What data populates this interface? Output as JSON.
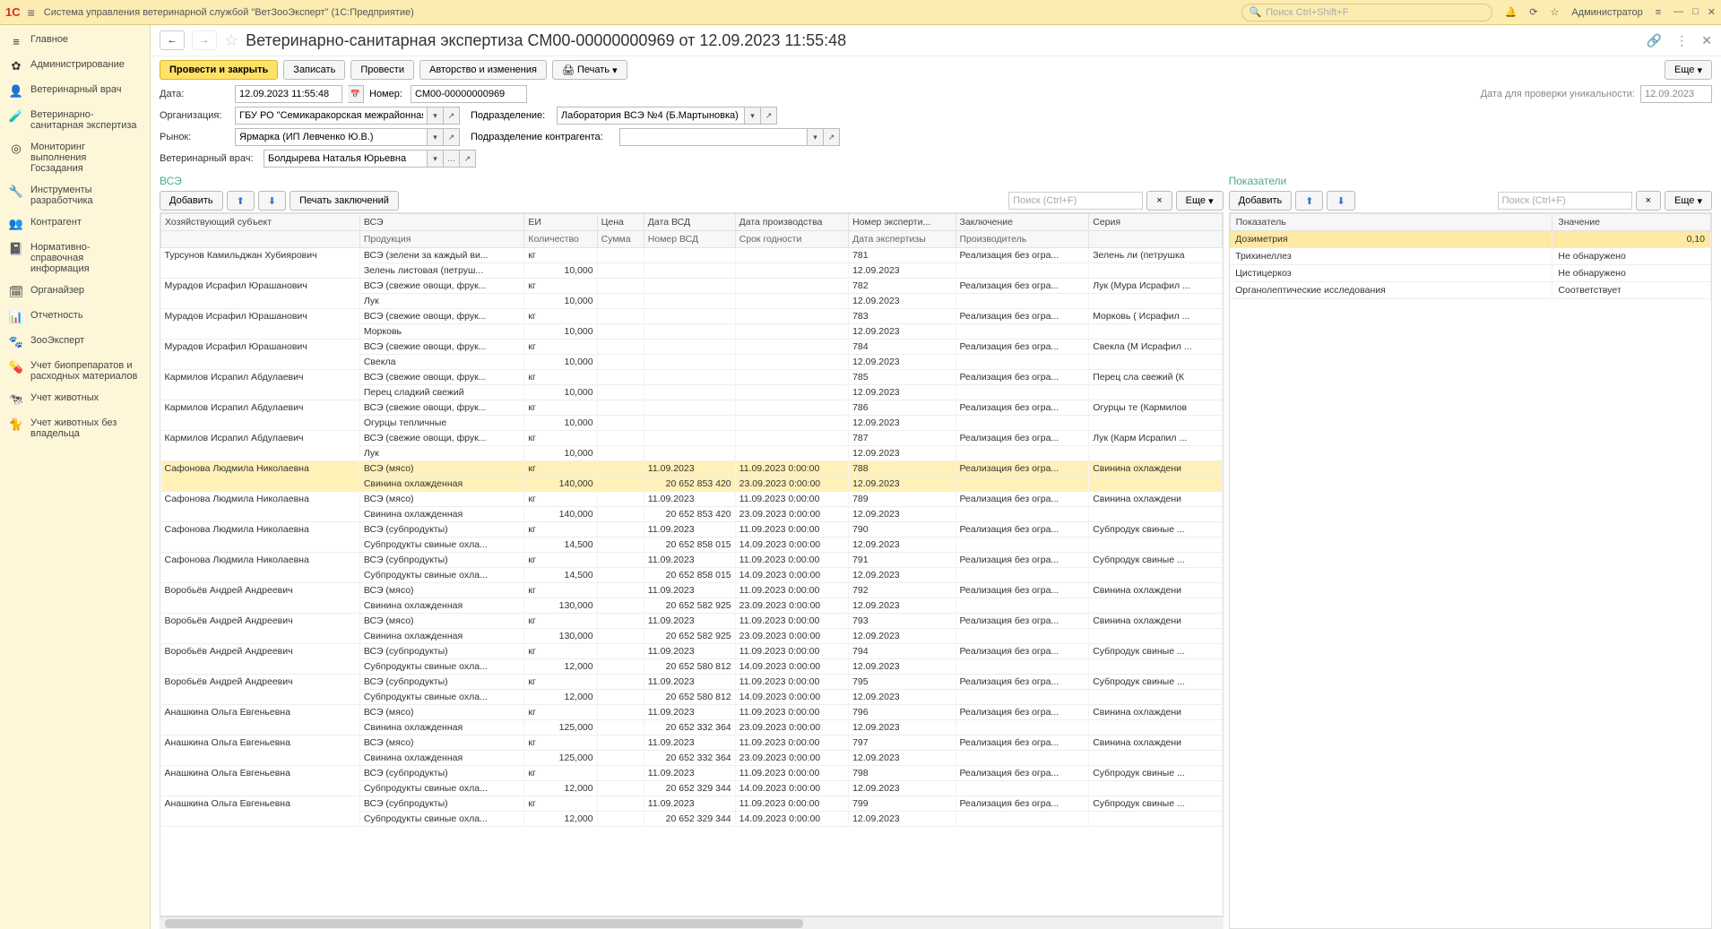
{
  "titlebar": {
    "app_title": "Система управления ветеринарной службой \"ВетЗооЭксперт\"  (1С:Предприятие)",
    "search_placeholder": "Поиск Ctrl+Shift+F",
    "user": "Администратор"
  },
  "sidebar": [
    {
      "icon": "≡",
      "label": "Главное"
    },
    {
      "icon": "✿",
      "label": "Администрирование"
    },
    {
      "icon": "👤",
      "label": "Ветеринарный врач"
    },
    {
      "icon": "🧪",
      "label": "Ветеринарно-санитарная экспертиза"
    },
    {
      "icon": "◎",
      "label": "Мониторинг выполнения Госзадания"
    },
    {
      "icon": "🔧",
      "label": "Инструменты разработчика"
    },
    {
      "icon": "👥",
      "label": "Контрагент"
    },
    {
      "icon": "📓",
      "label": "Нормативно-справочная информация"
    },
    {
      "icon": "🗓",
      "label": "Органайзер"
    },
    {
      "icon": "📊",
      "label": "Отчетность"
    },
    {
      "icon": "🐾",
      "label": "ЗооЭксперт"
    },
    {
      "icon": "💊",
      "label": "Учет биопрепаратов и расходных материалов"
    },
    {
      "icon": "🐄",
      "label": "Учет животных"
    },
    {
      "icon": "🐈",
      "label": "Учет животных без владельца"
    }
  ],
  "doc": {
    "title": "Ветеринарно-санитарная экспертиза СМ00-00000000969 от 12.09.2023 11:55:48",
    "btn_post_close": "Провести и закрыть",
    "btn_write": "Записать",
    "btn_post": "Провести",
    "btn_author": "Авторство и изменения",
    "btn_print": "Печать",
    "btn_more": "Еще"
  },
  "form": {
    "date_label": "Дата:",
    "date_value": "12.09.2023 11:55:48",
    "number_label": "Номер:",
    "number_value": "СМ00-00000000969",
    "unique_label": "Дата для проверки уникальности:",
    "unique_value": "12.09.2023",
    "org_label": "Организация:",
    "org_value": "ГБУ РО \"Семикаракорская межрайонная СББЖ\"",
    "dept_label": "Подразделение:",
    "dept_value": "Лаборатория ВСЭ №4 (Б.Мартыновка)",
    "market_label": "Рынок:",
    "market_value": "Ярмарка (ИП Левченко Ю.В.)",
    "cdept_label": "Подразделение контрагента:",
    "cdept_value": "",
    "vet_label": "Ветеринарный врач:",
    "vet_value": "Болдырева Наталья Юрьевна"
  },
  "vse_section": {
    "title": "ВСЭ",
    "btn_add": "Добавить",
    "btn_print_conclusion": "Печать заключений",
    "search_placeholder": "Поиск (Ctrl+F)",
    "btn_more": "Еще",
    "headers1": [
      "Хозяйствующий субъект",
      "ВСЭ",
      "ЕИ",
      "Цена",
      "Дата ВСД",
      "Дата производства",
      "Номер эксперти...",
      "Заключение",
      "Серия"
    ],
    "headers2": [
      "",
      "Продукция",
      "Количество",
      "Сумма",
      "Номер ВСД",
      "Срок годности",
      "Дата экспертизы",
      "Производитель",
      ""
    ],
    "rows": [
      {
        "subj": "Турсунов Камильджан Хубиярович",
        "vse": "ВСЭ (зелени за каждый ви...",
        "prod": "Зелень листовая (петруш...",
        "ei": "кг",
        "qty": "10,000",
        "vsd_date": "",
        "prod_date": "",
        "num": "781",
        "exp_date": "12.09.2023",
        "concl": "Реализация без огра...",
        "series": "Зелень ли (петрушка"
      },
      {
        "subj": "Мурадов Исрафил Юрашанович",
        "vse": "ВСЭ (свежие овощи, фрук...",
        "prod": "Лук",
        "ei": "кг",
        "qty": "10,000",
        "vsd_date": "",
        "prod_date": "",
        "num": "782",
        "exp_date": "12.09.2023",
        "concl": "Реализация без огра...",
        "series": "Лук (Мура Исрафил ..."
      },
      {
        "subj": "Мурадов Исрафил Юрашанович",
        "vse": "ВСЭ (свежие овощи, фрук...",
        "prod": "Морковь",
        "ei": "кг",
        "qty": "10,000",
        "vsd_date": "",
        "prod_date": "",
        "num": "783",
        "exp_date": "12.09.2023",
        "concl": "Реализация без огра...",
        "series": "Морковь ( Исрафил ..."
      },
      {
        "subj": "Мурадов Исрафил Юрашанович",
        "vse": "ВСЭ (свежие овощи, фрук...",
        "prod": "Свекла",
        "ei": "кг",
        "qty": "10,000",
        "vsd_date": "",
        "prod_date": "",
        "num": "784",
        "exp_date": "12.09.2023",
        "concl": "Реализация без огра...",
        "series": "Свекла (М Исрафил ..."
      },
      {
        "subj": "Кармилов Исрапил Абдулаевич",
        "vse": "ВСЭ (свежие овощи, фрук...",
        "prod": "Перец сладкий свежий",
        "ei": "кг",
        "qty": "10,000",
        "vsd_date": "",
        "prod_date": "",
        "num": "785",
        "exp_date": "12.09.2023",
        "concl": "Реализация без огра...",
        "series": "Перец сла свежий (К"
      },
      {
        "subj": "Кармилов Исрапил Абдулаевич",
        "vse": "ВСЭ (свежие овощи, фрук...",
        "prod": "Огурцы тепличные",
        "ei": "кг",
        "qty": "10,000",
        "vsd_date": "",
        "prod_date": "",
        "num": "786",
        "exp_date": "12.09.2023",
        "concl": "Реализация без огра...",
        "series": "Огурцы те (Кармилов"
      },
      {
        "subj": "Кармилов Исрапил Абдулаевич",
        "vse": "ВСЭ (свежие овощи, фрук...",
        "prod": "Лук",
        "ei": "кг",
        "qty": "10,000",
        "vsd_date": "",
        "prod_date": "",
        "num": "787",
        "exp_date": "12.09.2023",
        "concl": "Реализация без огра...",
        "series": "Лук (Карм Исрапил ..."
      },
      {
        "sel": true,
        "subj": "Сафонова Людмила Николаевна",
        "vse": "ВСЭ (мясо)",
        "prod": "Свинина охлажденная",
        "ei": "кг",
        "qty": "140,000",
        "vsd_date": "11.09.2023",
        "vsd_num": "20 652 853 420",
        "prod_date": "11.09.2023 0:00:00",
        "exp": "23.09.2023 0:00:00",
        "num": "788",
        "exp_date": "12.09.2023",
        "concl": "Реализация без огра...",
        "series": "Свинина охлаждени"
      },
      {
        "subj": "Сафонова Людмила Николаевна",
        "vse": "ВСЭ (мясо)",
        "prod": "Свинина охлажденная",
        "ei": "кг",
        "qty": "140,000",
        "vsd_date": "11.09.2023",
        "vsd_num": "20 652 853 420",
        "prod_date": "11.09.2023 0:00:00",
        "exp": "23.09.2023 0:00:00",
        "num": "789",
        "exp_date": "12.09.2023",
        "concl": "Реализация без огра...",
        "series": "Свинина охлаждени"
      },
      {
        "subj": "Сафонова Людмила Николаевна",
        "vse": "ВСЭ (субпродукты)",
        "prod": "Субпродукты свиные охла...",
        "ei": "кг",
        "qty": "14,500",
        "vsd_date": "11.09.2023",
        "vsd_num": "20 652 858 015",
        "prod_date": "11.09.2023 0:00:00",
        "exp": "14.09.2023 0:00:00",
        "num": "790",
        "exp_date": "12.09.2023",
        "concl": "Реализация без огра...",
        "series": "Субпродук свиные ..."
      },
      {
        "subj": "Сафонова Людмила Николаевна",
        "vse": "ВСЭ (субпродукты)",
        "prod": "Субпродукты свиные охла...",
        "ei": "кг",
        "qty": "14,500",
        "vsd_date": "11.09.2023",
        "vsd_num": "20 652 858 015",
        "prod_date": "11.09.2023 0:00:00",
        "exp": "14.09.2023 0:00:00",
        "num": "791",
        "exp_date": "12.09.2023",
        "concl": "Реализация без огра...",
        "series": "Субпродук свиные ..."
      },
      {
        "subj": "Воробьёв Андрей Андреевич",
        "vse": "ВСЭ (мясо)",
        "prod": "Свинина охлажденная",
        "ei": "кг",
        "qty": "130,000",
        "vsd_date": "11.09.2023",
        "vsd_num": "20 652 582 925",
        "prod_date": "11.09.2023 0:00:00",
        "exp": "23.09.2023 0:00:00",
        "num": "792",
        "exp_date": "12.09.2023",
        "concl": "Реализация без огра...",
        "series": "Свинина охлаждени"
      },
      {
        "subj": "Воробьёв Андрей Андреевич",
        "vse": "ВСЭ (мясо)",
        "prod": "Свинина охлажденная",
        "ei": "кг",
        "qty": "130,000",
        "vsd_date": "11.09.2023",
        "vsd_num": "20 652 582 925",
        "prod_date": "11.09.2023 0:00:00",
        "exp": "23.09.2023 0:00:00",
        "num": "793",
        "exp_date": "12.09.2023",
        "concl": "Реализация без огра...",
        "series": "Свинина охлаждени"
      },
      {
        "subj": "Воробьёв Андрей Андреевич",
        "vse": "ВСЭ (субпродукты)",
        "prod": "Субпродукты свиные охла...",
        "ei": "кг",
        "qty": "12,000",
        "vsd_date": "11.09.2023",
        "vsd_num": "20 652 580 812",
        "prod_date": "11.09.2023 0:00:00",
        "exp": "14.09.2023 0:00:00",
        "num": "794",
        "exp_date": "12.09.2023",
        "concl": "Реализация без огра...",
        "series": "Субпродук свиные ..."
      },
      {
        "subj": "Воробьёв Андрей Андреевич",
        "vse": "ВСЭ (субпродукты)",
        "prod": "Субпродукты свиные охла...",
        "ei": "кг",
        "qty": "12,000",
        "vsd_date": "11.09.2023",
        "vsd_num": "20 652 580 812",
        "prod_date": "11.09.2023 0:00:00",
        "exp": "14.09.2023 0:00:00",
        "num": "795",
        "exp_date": "12.09.2023",
        "concl": "Реализация без огра...",
        "series": "Субпродук свиные ..."
      },
      {
        "subj": "Анашкина Ольга Евгеньевна",
        "vse": "ВСЭ (мясо)",
        "prod": "Свинина охлажденная",
        "ei": "кг",
        "qty": "125,000",
        "vsd_date": "11.09.2023",
        "vsd_num": "20 652 332 364",
        "prod_date": "11.09.2023 0:00:00",
        "exp": "23.09.2023 0:00:00",
        "num": "796",
        "exp_date": "12.09.2023",
        "concl": "Реализация без огра...",
        "series": "Свинина охлаждени"
      },
      {
        "subj": "Анашкина Ольга Евгеньевна",
        "vse": "ВСЭ (мясо)",
        "prod": "Свинина охлажденная",
        "ei": "кг",
        "qty": "125,000",
        "vsd_date": "11.09.2023",
        "vsd_num": "20 652 332 364",
        "prod_date": "11.09.2023 0:00:00",
        "exp": "23.09.2023 0:00:00",
        "num": "797",
        "exp_date": "12.09.2023",
        "concl": "Реализация без огра...",
        "series": "Свинина охлаждени"
      },
      {
        "subj": "Анашкина Ольга Евгеньевна",
        "vse": "ВСЭ (субпродукты)",
        "prod": "Субпродукты свиные охла...",
        "ei": "кг",
        "qty": "12,000",
        "vsd_date": "11.09.2023",
        "vsd_num": "20 652 329 344",
        "prod_date": "11.09.2023 0:00:00",
        "exp": "14.09.2023 0:00:00",
        "num": "798",
        "exp_date": "12.09.2023",
        "concl": "Реализация без огра...",
        "series": "Субпродук свиные ..."
      },
      {
        "subj": "Анашкина Ольга Евгеньевна",
        "vse": "ВСЭ (субпродукты)",
        "prod": "Субпродукты свиные охла...",
        "ei": "кг",
        "qty": "12,000",
        "vsd_date": "11.09.2023",
        "vsd_num": "20 652 329 344",
        "prod_date": "11.09.2023 0:00:00",
        "exp": "14.09.2023 0:00:00",
        "num": "799",
        "exp_date": "12.09.2023",
        "concl": "Реализация без огра...",
        "series": "Субпродук свиные ..."
      }
    ]
  },
  "indicators": {
    "title": "Показатели",
    "btn_add": "Добавить",
    "search_placeholder": "Поиск (Ctrl+F)",
    "btn_more": "Еще",
    "headers": [
      "Показатель",
      "Значение"
    ],
    "rows": [
      {
        "sel": true,
        "name": "Дозиметрия",
        "value": "0,10"
      },
      {
        "name": "Трихинеллез",
        "value": "Не обнаружено"
      },
      {
        "name": "Цистицеркоз",
        "value": "Не обнаружено"
      },
      {
        "name": "Органолептические исследования",
        "value": "Соответствует"
      }
    ]
  }
}
